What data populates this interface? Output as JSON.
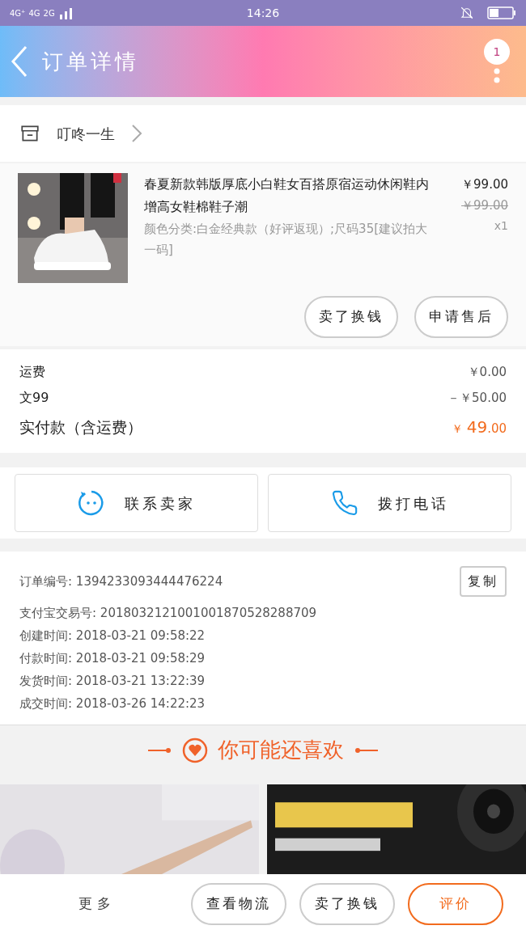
{
  "status_bar": {
    "networks": [
      "4G⁺",
      "4G",
      "2G"
    ],
    "time": "14:26"
  },
  "header": {
    "title": "订单详情",
    "badge": "1"
  },
  "shop": {
    "name": "叮咚一生"
  },
  "item": {
    "title": "春夏新款韩版厚底小白鞋女百搭原宿运动休闲鞋内增高女鞋棉鞋子潮",
    "specs": "颜色分类:白金经典款（好评返现）;尺码35[建议拍大一码]",
    "price": "￥99.00",
    "original_price": "￥99.00",
    "quantity": "x1",
    "actions": [
      "卖了换钱",
      "申请售后"
    ]
  },
  "costs": [
    {
      "label": "运费",
      "value": "￥0.00"
    },
    {
      "label": "文99",
      "value": "－￥50.00"
    }
  ],
  "total": {
    "label": "实付款（含运费）",
    "currency": "￥",
    "integer": "49",
    "decimal": ".00"
  },
  "contact": [
    {
      "kind": "chat",
      "label": "联系卖家"
    },
    {
      "kind": "phone",
      "label": "拨打电话"
    }
  ],
  "order_info": {
    "copy": "复制",
    "rows": [
      {
        "label": "订单编号:",
        "value": "1394233093444476224"
      },
      {
        "label": "支付宝交易号:",
        "value": "2018032121001001870528288709"
      },
      {
        "label": "创建时间:",
        "value": "2018-03-21 09:58:22"
      },
      {
        "label": "付款时间:",
        "value": "2018-03-21 09:58:29"
      },
      {
        "label": "发货时间:",
        "value": "2018-03-21 13:22:39"
      },
      {
        "label": "成交时间:",
        "value": "2018-03-26 14:22:23"
      }
    ]
  },
  "recommend": {
    "title": "你可能还喜欢"
  },
  "bottom_bar": {
    "more": "更多",
    "buttons": [
      {
        "label": "查看物流",
        "selected": false
      },
      {
        "label": "卖了换钱",
        "selected": false
      },
      {
        "label": "评价",
        "selected": true
      }
    ]
  }
}
